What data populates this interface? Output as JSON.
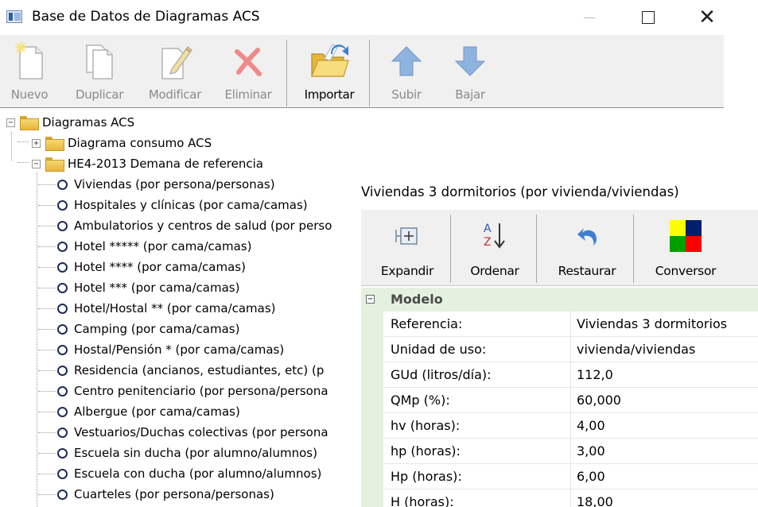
{
  "window": {
    "title": "Base de Datos de Diagramas ACS",
    "minimize_icon": "minimize-icon",
    "maximize_icon": "maximize-icon",
    "close_glyph": "✕"
  },
  "toolbar": {
    "items": [
      {
        "label": "Nuevo",
        "icon": "new-document-icon",
        "enabled": false
      },
      {
        "label": "Duplicar",
        "icon": "duplicate-icon",
        "enabled": false
      },
      {
        "label": "Modificar",
        "icon": "edit-icon",
        "enabled": false
      },
      {
        "label": "Eliminar",
        "icon": "delete-icon",
        "enabled": false
      },
      {
        "label": "Importar",
        "icon": "import-folder-icon",
        "enabled": true
      },
      {
        "label": "Subir",
        "icon": "arrow-up-icon",
        "enabled": false
      },
      {
        "label": "Bajar",
        "icon": "arrow-down-icon",
        "enabled": false
      }
    ]
  },
  "tree": {
    "root": {
      "label": "Diagramas ACS",
      "expanded": true
    },
    "groups": [
      {
        "label": "Diagrama consumo ACS",
        "expanded": false
      },
      {
        "label": "HE4-2013 Demana de referencia",
        "expanded": true
      }
    ],
    "leaves": [
      "Viviendas (por persona/personas)",
      "Hospitales y clínicas (por cama/camas)",
      "Ambulatorios y centros de salud (por perso",
      "Hotel ***** (por cama/camas)",
      "Hotel **** (por cama/camas)",
      "Hotel *** (por cama/camas)",
      "Hotel/Hostal ** (por cama/camas)",
      "Camping (por cama/camas)",
      "Hostal/Pensión * (por cama/camas)",
      "Residencia (ancianos, estudiantes, etc) (p",
      "Centro penitenciario (por persona/persona",
      "Albergue (por cama/camas)",
      "Vestuarios/Duchas colectivas (por persona",
      "Escuela sin ducha (por alumno/alumnos)",
      "Escuela con ducha (por alumno/alumnos)",
      "Cuarteles (por persona/personas)"
    ]
  },
  "panel": {
    "title": "Viviendas 3 dormitorios (por vivienda/viviendas)",
    "toolbar": [
      {
        "label": "Expandir",
        "icon": "expand-icon"
      },
      {
        "label": "Ordenar",
        "icon": "sort-az-icon"
      },
      {
        "label": "Restaurar",
        "icon": "undo-icon"
      },
      {
        "label": "Conversor",
        "icon": "color-grid-icon"
      }
    ],
    "colors": [
      "#ffff00",
      "#00206e",
      "#00a000",
      "#ff0000"
    ],
    "category": "Modelo",
    "category_toggle": "−",
    "rows": [
      {
        "name": "Referencia:",
        "value": "Viviendas 3 dormitorios"
      },
      {
        "name": "Unidad de uso:",
        "value": "vivienda/viviendas"
      },
      {
        "name": "GUd (litros/día):",
        "value": "112,0"
      },
      {
        "name": "QMp (%):",
        "value": "60,000"
      },
      {
        "name": "hv (horas):",
        "value": "4,00"
      },
      {
        "name": "hp (horas):",
        "value": "3,00"
      },
      {
        "name": "Hp (horas):",
        "value": "6,00"
      },
      {
        "name": "H (horas):",
        "value": "18,00"
      }
    ]
  }
}
